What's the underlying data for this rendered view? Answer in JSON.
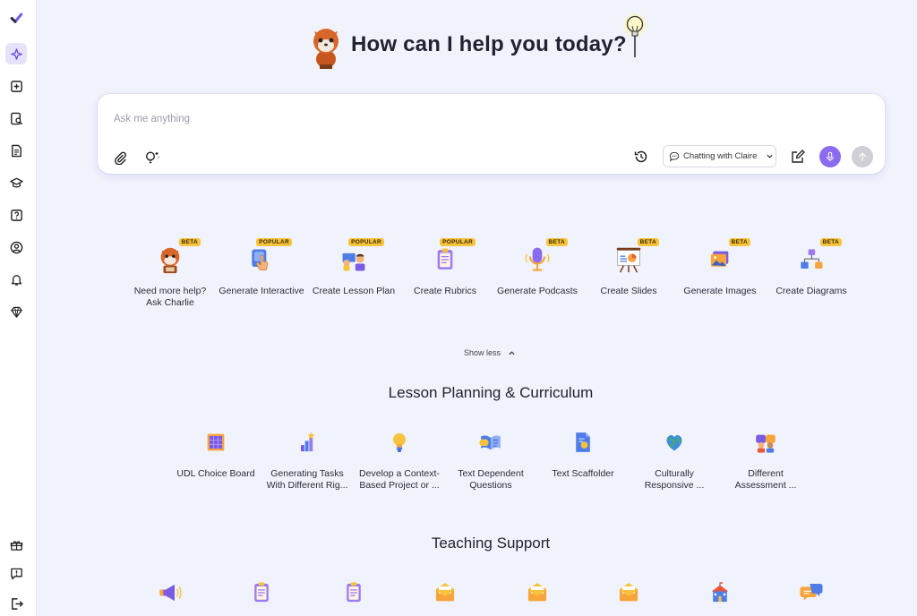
{
  "hero": {
    "title": "How can I help you today?"
  },
  "chat": {
    "placeholder": "Ask me anything",
    "mode_label": "Chatting with Claire"
  },
  "features": [
    {
      "label": "Need more help? Ask Charlie",
      "badge": "BETA",
      "icon": "fox-icon"
    },
    {
      "label": "Generate Interactive",
      "badge": "POPULAR",
      "icon": "touch-card-icon"
    },
    {
      "label": "Create Lesson Plan",
      "badge": "POPULAR",
      "icon": "teacher-board-icon"
    },
    {
      "label": "Create Rubrics",
      "badge": "POPULAR",
      "icon": "clipboard-icon"
    },
    {
      "label": "Generate Podcasts",
      "badge": "BETA",
      "icon": "microphone-icon"
    },
    {
      "label": "Create Slides",
      "badge": "BETA",
      "icon": "presentation-icon"
    },
    {
      "label": "Generate Images",
      "badge": "BETA",
      "icon": "image-icon"
    },
    {
      "label": "Create Diagrams",
      "badge": "BETA",
      "icon": "diagram-icon"
    }
  ],
  "show_less_label": "Show less",
  "sections": {
    "lesson_planning": {
      "title": "Lesson Planning & Curriculum",
      "items": [
        {
          "label": "UDL Choice Board",
          "icon": "grid-board-icon"
        },
        {
          "label": "Generating Tasks With Different Rig...",
          "icon": "growth-bars-icon"
        },
        {
          "label": "Develop a Context-Based Project or ...",
          "icon": "lightbulb-icon"
        },
        {
          "label": "Text Dependent Questions",
          "icon": "open-book-icon"
        },
        {
          "label": "Text Scaffolder",
          "icon": "document-icon"
        },
        {
          "label": "Culturally Responsive ...",
          "icon": "globe-icon"
        },
        {
          "label": "Different Assessment ...",
          "icon": "people-icon"
        }
      ]
    },
    "teaching_support": {
      "title": "Teaching Support",
      "items": [
        {
          "icon": "megaphone-icon"
        },
        {
          "icon": "clipboard-icon"
        },
        {
          "icon": "clipboard-icon"
        },
        {
          "icon": "envelope-icon"
        },
        {
          "icon": "envelope-icon"
        },
        {
          "icon": "envelope-icon"
        },
        {
          "icon": "school-icon"
        },
        {
          "icon": "chat-bubbles-icon"
        }
      ]
    }
  },
  "colors": {
    "accent": "#8b6cf0",
    "badge": "#f7c33c",
    "background": "#f1f3fc"
  }
}
